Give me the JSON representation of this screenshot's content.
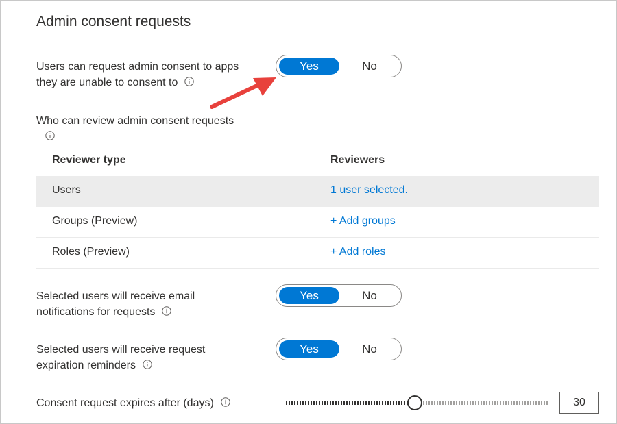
{
  "section": {
    "title": "Admin consent requests"
  },
  "request_consent": {
    "label_line1": "Users can request admin consent to apps",
    "label_line2": "they are unable to consent to",
    "yes": "Yes",
    "no": "No",
    "selected": "Yes"
  },
  "reviewers": {
    "label": "Who can review admin consent requests",
    "columns": [
      "Reviewer type",
      "Reviewers"
    ],
    "rows": [
      {
        "type": "Users",
        "reviewers": "1 user selected.",
        "selected": true
      },
      {
        "type": "Groups (Preview)",
        "reviewers": "+ Add groups",
        "selected": false
      },
      {
        "type": "Roles (Preview)",
        "reviewers": "+ Add roles",
        "selected": false
      }
    ]
  },
  "email_notifications": {
    "label_line1": "Selected users will receive email",
    "label_line2": "notifications for requests",
    "yes": "Yes",
    "no": "No",
    "selected": "Yes"
  },
  "expiration_reminders": {
    "label_line1": "Selected users will receive request",
    "label_line2": "expiration reminders",
    "yes": "Yes",
    "no": "No",
    "selected": "Yes"
  },
  "expiry": {
    "label": "Consent request expires after (days)",
    "value": "30",
    "slider_fraction": 0.49
  },
  "colors": {
    "accent": "#0078d4",
    "annotation_arrow": "#e8413c",
    "selected_row": "#ececec"
  }
}
